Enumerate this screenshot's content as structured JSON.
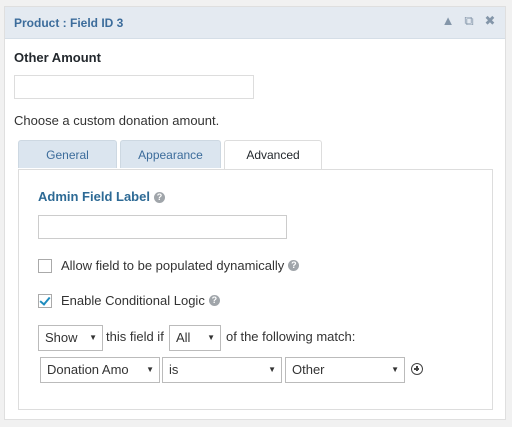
{
  "panel": {
    "title": "Product : Field ID 3",
    "icons": [
      "collapse-icon",
      "duplicate-icon",
      "close-icon"
    ]
  },
  "field": {
    "label": "Other Amount",
    "value": "",
    "description": "Choose a custom donation amount."
  },
  "tabs": [
    {
      "label": "General",
      "active": false
    },
    {
      "label": "Appearance",
      "active": false
    },
    {
      "label": "Advanced",
      "active": true
    }
  ],
  "advanced": {
    "admin_label": "Admin Field Label",
    "admin_value": "",
    "allow_dynamic": {
      "label": "Allow field to be populated dynamically",
      "checked": false
    },
    "conditional": {
      "label": "Enable Conditional Logic",
      "checked": true
    },
    "logic": {
      "action": "Show",
      "text1": "this field if",
      "match": "All",
      "text2": "of the following match:",
      "rule": {
        "field": "Donation Amo",
        "operator": "is",
        "value": "Other"
      }
    }
  }
}
